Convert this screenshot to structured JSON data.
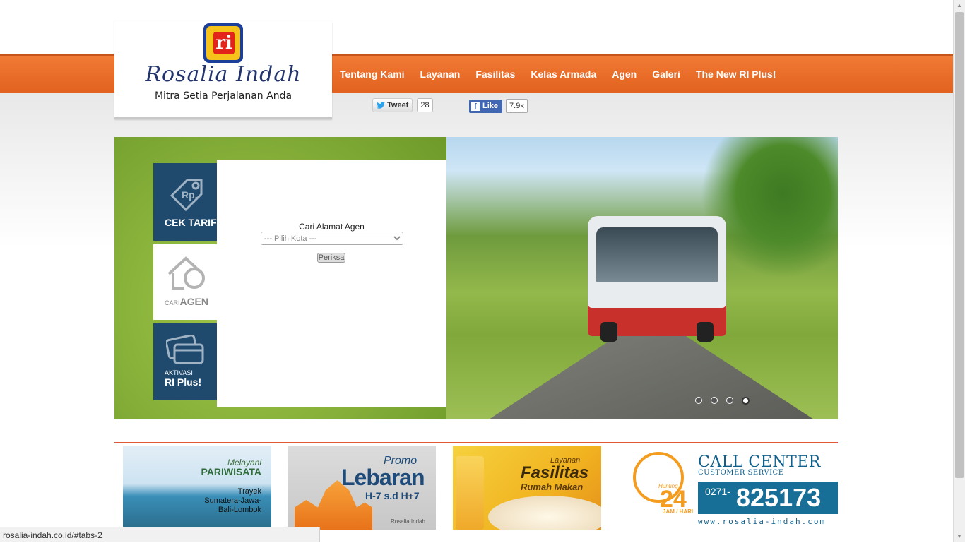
{
  "brand": {
    "name": "Rosalia Indah",
    "tagline": "Mitra Setia Perjalanan Anda",
    "logo_letters": "ri"
  },
  "nav": {
    "items": [
      {
        "label": "Tentang Kami"
      },
      {
        "label": "Layanan"
      },
      {
        "label": "Fasilitas"
      },
      {
        "label": "Kelas Armada"
      },
      {
        "label": "Agen"
      },
      {
        "label": "Galeri"
      },
      {
        "label": "The New RI Plus!"
      }
    ]
  },
  "social": {
    "tweet_label": "Tweet",
    "tweet_count": "28",
    "like_label": "Like",
    "like_count": "7.9k"
  },
  "hero": {
    "tabs": [
      {
        "small": "",
        "label": "CEK TARIF",
        "icon": "price-tag-icon",
        "active": false
      },
      {
        "small": "CARI",
        "label": "AGEN",
        "icon": "house-search-icon",
        "active": true
      },
      {
        "small": "AKTIVASI",
        "label": "RI Plus!",
        "icon": "cards-icon",
        "active": false
      }
    ],
    "panel": {
      "title": "Cari Alamat Agen",
      "select_placeholder": "--- Pilih Kota ---",
      "button_label": "Periksa"
    },
    "slides_total": 4,
    "slide_active": 4
  },
  "banners": [
    {
      "line1": "Melayani",
      "line2": "PARIWISATA",
      "line3": "Trayek",
      "line4": "Sumatera-Jawa-",
      "line5": "Bali-Lombok"
    },
    {
      "line1": "Promo",
      "line2": "Lebaran",
      "line3": "H-7 s.d H+7",
      "line4": "Rosalia Indah"
    },
    {
      "line1": "Layanan",
      "line2": "Fasilitas",
      "line3": "Rumah Makan"
    }
  ],
  "call_center": {
    "title": "CALL CENTER",
    "subtitle": "CUSTOMER SERVICE",
    "hotline": "Hunting",
    "hours": "24",
    "hours_label": "JAM / HARI",
    "phone_prefix": "0271-",
    "phone_number": "825173",
    "url": "www.rosalia-indah.com"
  },
  "status_bar": {
    "text": "rosalia-indah.co.id/#tabs-2"
  },
  "colors": {
    "nav_orange": "#e8692a",
    "tab_navy": "#1f4a6d",
    "accent_blue": "#176f98"
  }
}
